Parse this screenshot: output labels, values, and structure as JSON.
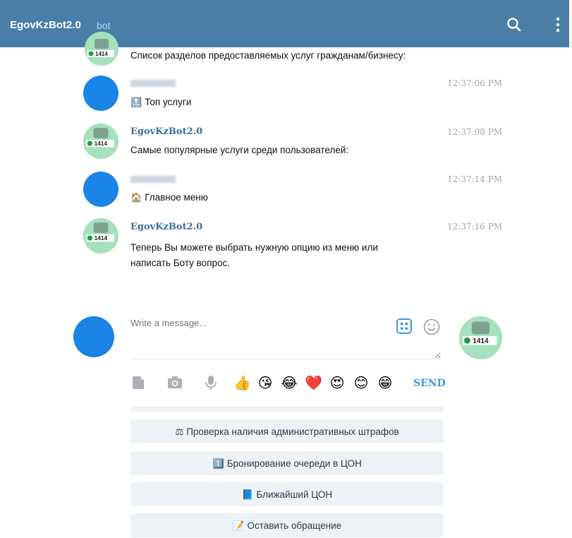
{
  "header": {
    "title": "EgovKzBot2.0",
    "subtitle": "bot",
    "bg_color": "#4a7ea7"
  },
  "messages": [
    {
      "text": "Список разделов предоставляемых услуг гражданам/бизнесу:"
    },
    {
      "time": "12:37:06 PM",
      "emoji": "🔝",
      "text": "Топ услуги"
    },
    {
      "sender": "EgovKzBot2.0",
      "time": "12:37:08 PM",
      "text": "Самые популярные услуги среди пользователей:"
    },
    {
      "time": "12:37:14 PM",
      "emoji": "🏠",
      "text": "Главное меню"
    },
    {
      "sender": "EgovKzBot2.0",
      "time": "12:37:16 PM",
      "text_line1": "Теперь Вы можете выбрать нужную опцию из меню или",
      "text_line2": "написать Боту вопрос."
    }
  ],
  "composer": {
    "placeholder": "Write a message...",
    "send_label": "SEND",
    "reactions": [
      "👍",
      "😘",
      "😂",
      "❤️",
      "😍",
      "😊",
      "😁"
    ],
    "accent_color": "#3f97dd"
  },
  "keyboard": {
    "buttons": [
      {
        "emoji": "⚖",
        "label": "Проверка наличия административных штрафов"
      },
      {
        "emoji": "1️⃣",
        "label": "Бронирование очереди в ЦОН"
      },
      {
        "emoji": "📘",
        "label": "Ближайший ЦОН"
      },
      {
        "emoji": "📝",
        "label": "Оставить обращение"
      }
    ]
  },
  "icons": {
    "search": "search-icon",
    "menu": "more-vertical-icon",
    "keyboard": "keyboard-grid-icon",
    "smile": "smile-icon",
    "file": "file-icon",
    "camera": "camera-icon",
    "mic": "microphone-icon"
  },
  "bot_avatar_label": "1414"
}
